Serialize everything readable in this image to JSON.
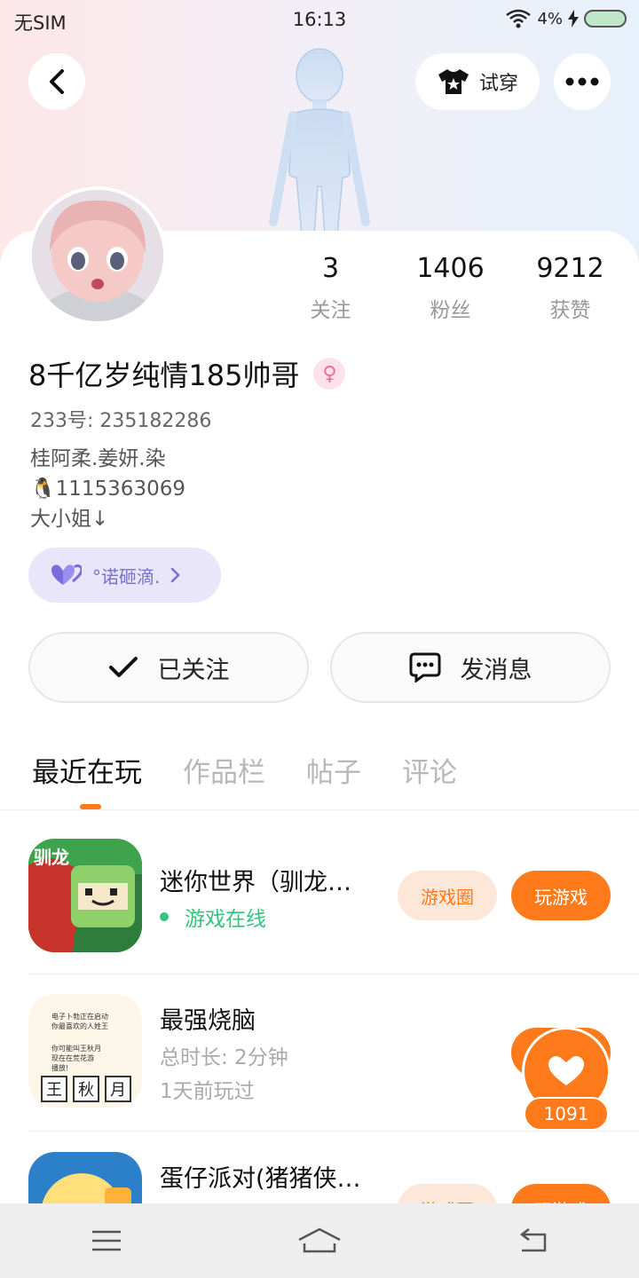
{
  "status_bar": {
    "carrier": "无SIM",
    "time": "16:13",
    "battery": "4%"
  },
  "header": {
    "try_on_label": "试穿"
  },
  "profile": {
    "name": "8千亿岁纯情185帅哥",
    "gender_symbol": "♀",
    "uid": "233号: 235182286",
    "bio_lines": [
      "桂阿柔.姜妍.染",
      "🐧1115363069",
      "大小姐↓"
    ],
    "badge_label": "°诺砸滴."
  },
  "stats": [
    {
      "value": "3",
      "label": "关注"
    },
    {
      "value": "1406",
      "label": "粉丝"
    },
    {
      "value": "9212",
      "label": "获赞"
    }
  ],
  "actions": {
    "follow_label": "已关注",
    "message_label": "发消息"
  },
  "tabs": [
    "最近在玩",
    "作品栏",
    "帖子",
    "评论"
  ],
  "games": [
    {
      "title": "迷你世界（驯龙…",
      "status": "游戏在线",
      "circle_label": "游戏圈",
      "play_label": "玩游戏"
    },
    {
      "title": "最强烧脑",
      "duration": "总时长: 2分钟",
      "last_played": "1天前玩过",
      "icon_text": [
        "王",
        "秋",
        "月"
      ],
      "icon_note": [
        "电子卜勃正在启动",
        "你最喜欢的人姓王",
        "你可能叫王秋月",
        "现在在荒花游",
        "播放!"
      ]
    },
    {
      "title": "蛋仔派对(猪猪侠…",
      "circle_label": "游戏圈",
      "play_label": "玩游戏"
    }
  ],
  "like_count": "1091",
  "colors": {
    "accent": "#ff7a1a",
    "online": "#33c47e",
    "badge": "#7a71c9"
  }
}
